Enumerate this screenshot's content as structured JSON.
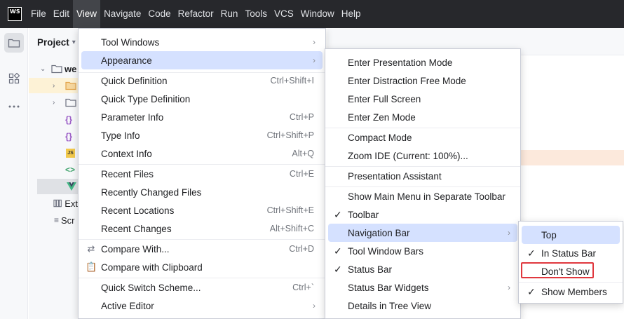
{
  "app": {
    "logo_text": "WS"
  },
  "menubar": {
    "items": [
      "File",
      "Edit",
      "View",
      "Navigate",
      "Code",
      "Refactor",
      "Run",
      "Tools",
      "VCS",
      "Window",
      "Help"
    ],
    "active_index": 2
  },
  "project": {
    "title": "Project",
    "root_label": "we",
    "rows": [
      {
        "icon": "folder-icon",
        "label": ""
      },
      {
        "icon": "folder-icon",
        "label": ""
      },
      {
        "icon": "json-file-icon",
        "label": ""
      },
      {
        "icon": "json-file-icon",
        "label": ""
      },
      {
        "icon": "js-file-icon",
        "label": ""
      },
      {
        "icon": "html-file-icon",
        "label": ""
      },
      {
        "icon": "vue-file-icon",
        "label": ""
      },
      {
        "icon": "external-libraries-icon",
        "label": "Ext"
      },
      {
        "icon": "scratches-icon",
        "label": "Scr"
      }
    ]
  },
  "view_menu": {
    "items": [
      {
        "label": "Tool Windows",
        "shortcut": "",
        "submenu": true
      },
      {
        "label": "Appearance",
        "shortcut": "",
        "submenu": true,
        "selected": true
      },
      {
        "label": "Quick Definition",
        "shortcut": "Ctrl+Shift+I"
      },
      {
        "label": "Quick Type Definition",
        "shortcut": ""
      },
      {
        "label": "Parameter Info",
        "shortcut": "Ctrl+P"
      },
      {
        "label": "Type Info",
        "shortcut": "Ctrl+Shift+P"
      },
      {
        "label": "Context Info",
        "shortcut": "Alt+Q"
      },
      {
        "label": "Recent Files",
        "shortcut": "Ctrl+E"
      },
      {
        "label": "Recently Changed Files",
        "shortcut": ""
      },
      {
        "label": "Recent Locations",
        "shortcut": "Ctrl+Shift+E"
      },
      {
        "label": "Recent Changes",
        "shortcut": "Alt+Shift+C"
      },
      {
        "label": "Compare With...",
        "shortcut": "Ctrl+D"
      },
      {
        "label": "Compare with Clipboard",
        "shortcut": ""
      },
      {
        "label": "Quick Switch Scheme...",
        "shortcut": "Ctrl+`"
      },
      {
        "label": "Active Editor",
        "shortcut": "",
        "submenu": true
      }
    ]
  },
  "appearance_menu": {
    "items": [
      {
        "label": "Enter Presentation Mode"
      },
      {
        "label": "Enter Distraction Free Mode"
      },
      {
        "label": "Enter Full Screen"
      },
      {
        "label": "Enter Zen Mode"
      },
      {
        "label": "Compact Mode"
      },
      {
        "label": "Zoom IDE (Current: 100%)..."
      },
      {
        "label": "Presentation Assistant"
      },
      {
        "label": "Show Main Menu in Separate Toolbar"
      },
      {
        "label": "Toolbar",
        "checked": true
      },
      {
        "label": "Navigation Bar",
        "submenu": true,
        "selected": true
      },
      {
        "label": "Tool Window Bars",
        "checked": true
      },
      {
        "label": "Status Bar",
        "checked": true
      },
      {
        "label": "Status Bar Widgets",
        "submenu": true
      },
      {
        "label": "Details in Tree View"
      }
    ]
  },
  "navbar_menu": {
    "items": [
      {
        "label": "Top",
        "selected": true
      },
      {
        "label": "In Status Bar",
        "checked": true
      },
      {
        "label": "Don't Show"
      },
      {
        "label": "Show Members",
        "checked": true
      }
    ]
  },
  "colors": {
    "accent_selection": "#d5e1ff",
    "highlight_box": "#e0383e",
    "menubar_bg": "#27282c"
  }
}
